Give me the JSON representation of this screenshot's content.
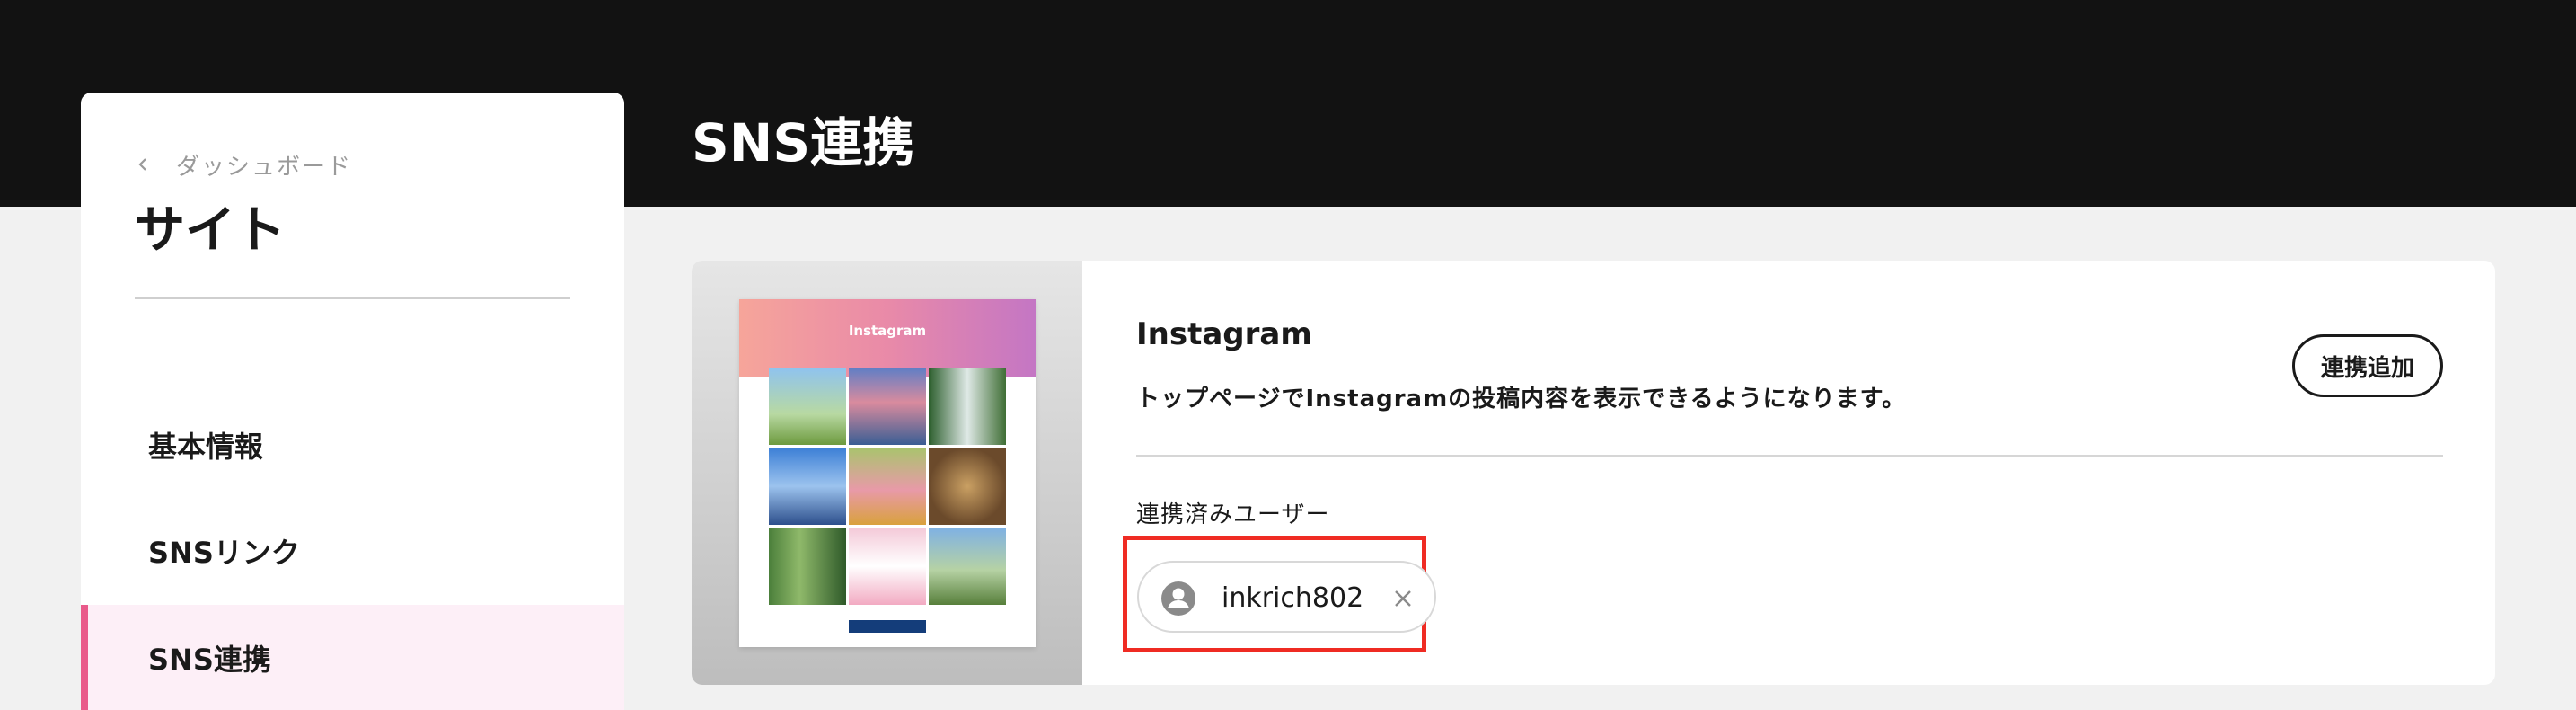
{
  "sidebar": {
    "back_label": "ダッシュボード",
    "title": "サイト",
    "items": [
      {
        "label": "基本情報",
        "active": false
      },
      {
        "label": "SNSリンク",
        "active": false
      },
      {
        "label": "SNS連携",
        "active": true
      }
    ]
  },
  "main": {
    "page_title": "SNS連携",
    "card": {
      "preview": {
        "title": "Instagram"
      },
      "service_name": "Instagram",
      "description": "トップページでInstagramの投稿内容を表示できるようになります。",
      "add_button_label": "連携追加",
      "linked_users_label": "連携済みユーザー",
      "linked_users": [
        {
          "username": "inkrich802"
        }
      ]
    }
  },
  "colors": {
    "topbar": "#121212",
    "active_nav_bg": "#fdeff7",
    "active_nav_accent": "#e95a8a",
    "highlight_border": "#ef2b23"
  },
  "icons": {
    "back": "chevron-left-icon",
    "user": "user-circle-icon",
    "remove": "close-icon"
  }
}
